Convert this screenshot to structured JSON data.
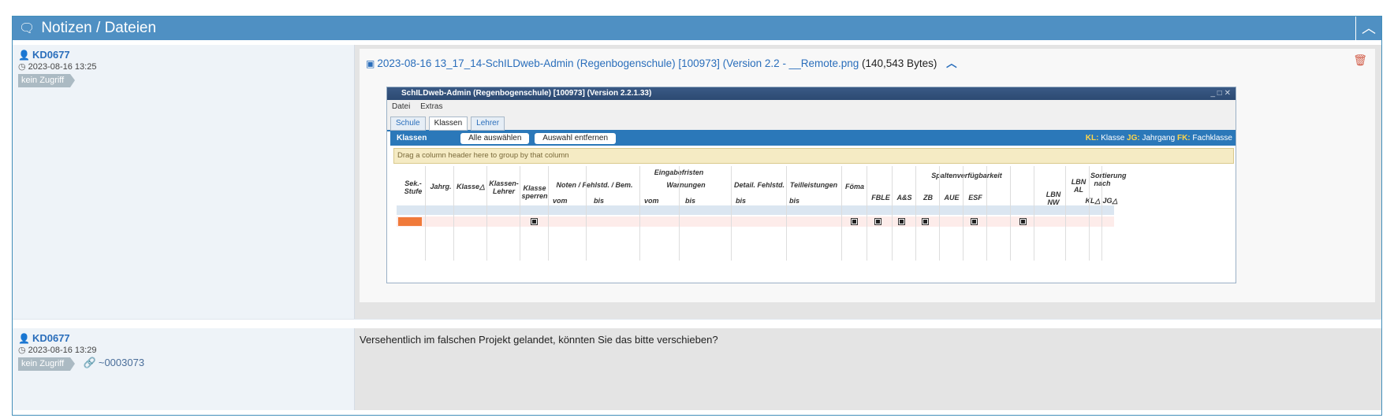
{
  "panel": {
    "title": "Notizen / Dateien",
    "title_icon": "comments-icon",
    "collapse_icon": "chevron-up-icon"
  },
  "notes": [
    {
      "user": "KD0677",
      "date": "2023-08-16 13:25",
      "badge": "kein Zugriff",
      "attachment": {
        "file_name": "2023-08-16 13_17_14-SchILDweb-Admin (Regenbogenschule) [100973] (Version 2.2 - __Remote.png",
        "file_size": "(140,543 Bytes)"
      }
    },
    {
      "user": "KD0677",
      "date": "2023-08-16 13:29",
      "badge": "kein Zugriff",
      "reference": "~0003073",
      "text": "Versehentlich im falschen Projekt gelandet, könnten Sie das bitte verschieben?"
    }
  ],
  "screenshot": {
    "title": "SchILDweb-Admin  (Regenbogenschule) [100973]   (Version 2.2.1.33)",
    "window_controls": "_ □ ✕",
    "menu": [
      "Datei",
      "Extras"
    ],
    "tabs": [
      "Schule",
      "Klassen",
      "Lehrer"
    ],
    "bar_title": "Klassen",
    "btn_select_all": "Alle auswählen",
    "btn_remove_selection": "Auswahl entfernen",
    "legend_kl": "KL:",
    "legend_kl_text": "Klasse",
    "legend_jg": "JG:",
    "legend_jg_text": "Jahrgang",
    "legend_fk": "FK:",
    "legend_fk_text": "Fachklasse",
    "drag_hint": "Drag a column header here to group by that column",
    "headers": {
      "sek": "Sek.-Stufe",
      "jahrg": "Jahrg.",
      "klasse": "Klasse△",
      "klassenlehrer": "Klassen-Lehrer",
      "eingabefristen": "Eingabefristen",
      "klasse_sperren": "Klasse sperren",
      "noten": "Noten / Fehlstd. / Bem.",
      "warnungen": "Warnungen",
      "detail": "Detail. Fehlstd.",
      "teilleistungen": "Teilleistungen",
      "foema": "Föma",
      "spalten": "Spaltenverfügbarkeit",
      "lbn_al": "LBN AL",
      "sortierung": "Sortierung nach",
      "vom": "vom",
      "bis": "bis",
      "fble": "FBLE",
      "as": "A&S",
      "zb": "ZB",
      "aue": "AUE",
      "esf": "ESF",
      "lbn_nw": "LBN NW",
      "kl": "KL△",
      "jg": "JG△"
    }
  }
}
